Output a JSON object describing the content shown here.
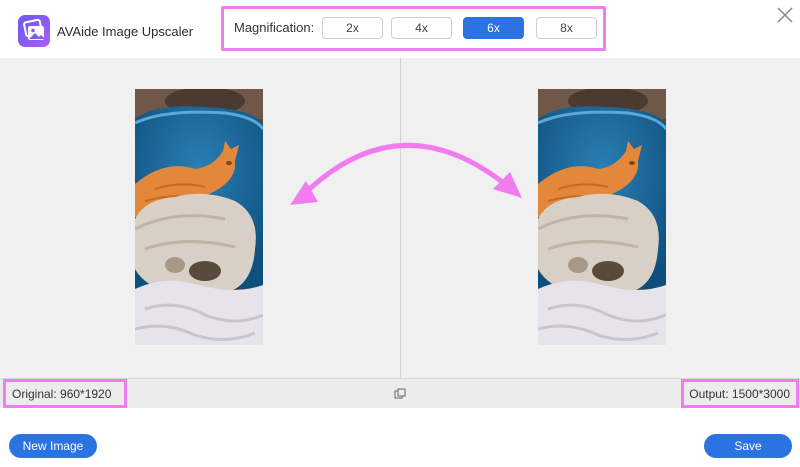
{
  "app": {
    "title": "AVAide Image Upscaler",
    "logo_icon": "image-gallery-icon"
  },
  "magnification": {
    "label": "Magnification:",
    "options": [
      "2x",
      "4x",
      "6x",
      "8x"
    ],
    "selected": "6x"
  },
  "window": {
    "close_icon": "close-icon"
  },
  "preview": {
    "original_image": "cat-and-dog-photo",
    "output_image": "cat-and-dog-photo-upscaled",
    "arrows": "curved-double-arrow"
  },
  "info": {
    "original_label": "Original: 960*1920",
    "output_label": "Output: 1500*3000",
    "compare_icon": "compare-icon"
  },
  "footer": {
    "new_image_label": "New Image",
    "save_label": "Save"
  },
  "colors": {
    "accent": "#2b73e3",
    "highlight": "#f07cf0",
    "preview_bg": "#f0f0f0"
  }
}
